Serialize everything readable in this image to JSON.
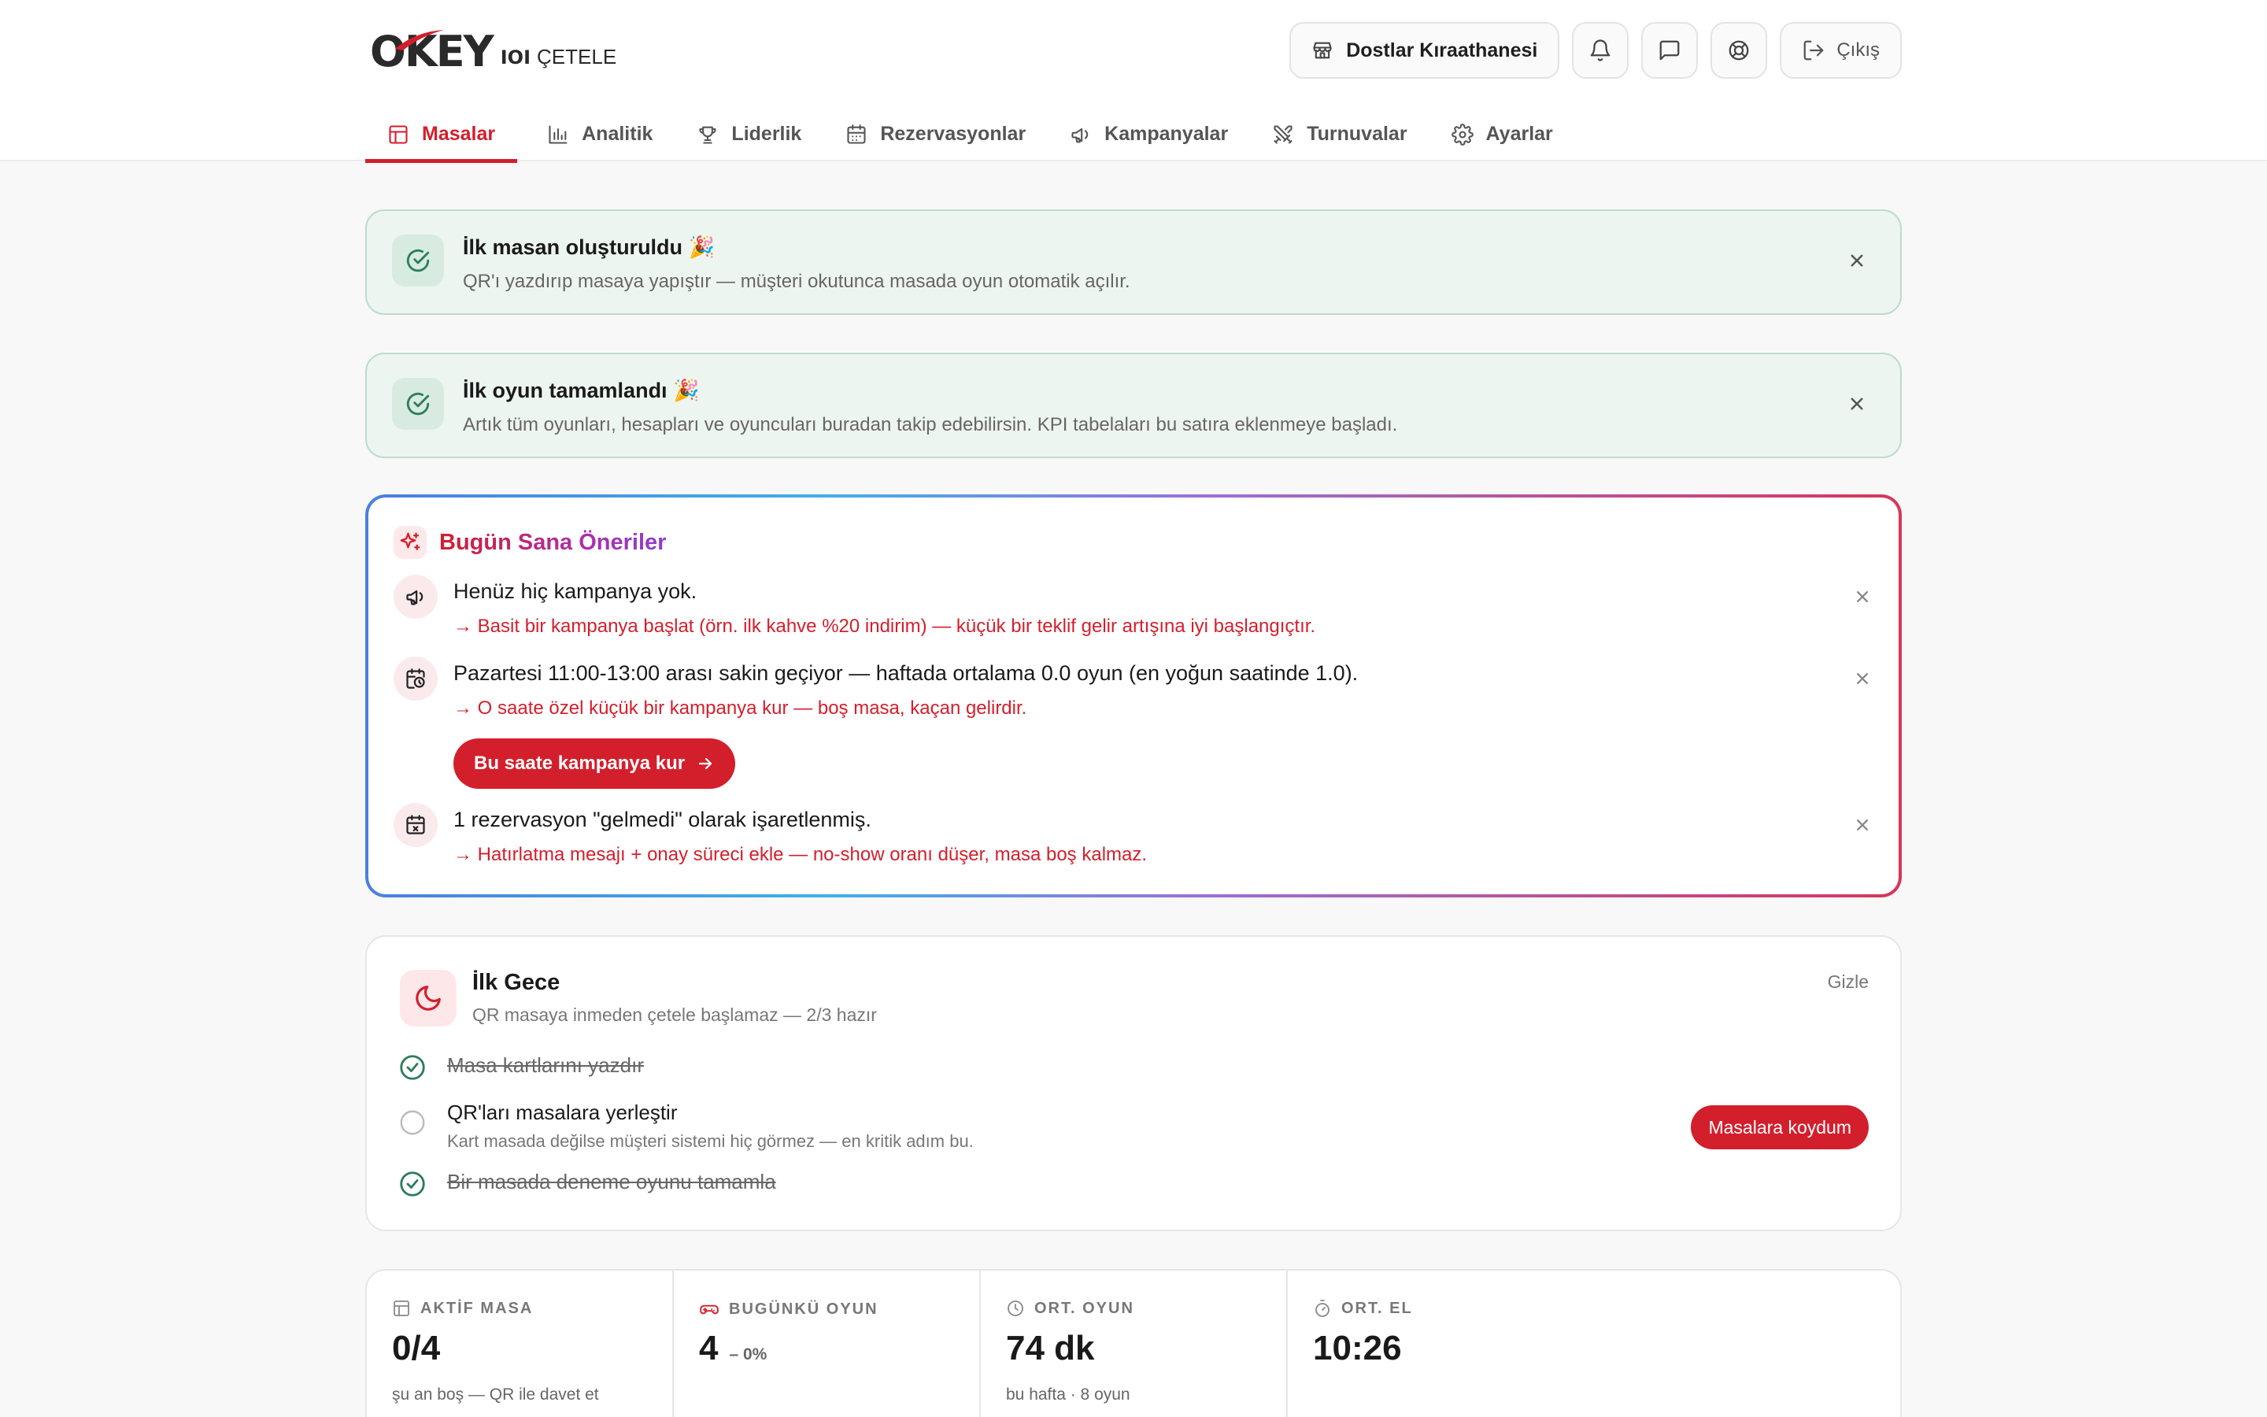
{
  "logo": {
    "brand": "OKEY",
    "io": "IOI",
    "sub": "ÇETELE"
  },
  "header": {
    "venue": "Dostlar Kıraathanesi",
    "logout": "Çıkış"
  },
  "nav": [
    {
      "label": "Masalar",
      "icon": "table-icon"
    },
    {
      "label": "Analitik",
      "icon": "bar-chart-icon"
    },
    {
      "label": "Liderlik",
      "icon": "trophy-icon"
    },
    {
      "label": "Rezervasyonlar",
      "icon": "calendar-icon"
    },
    {
      "label": "Kampanyalar",
      "icon": "megaphone-icon"
    },
    {
      "label": "Turnuvalar",
      "icon": "swords-icon"
    },
    {
      "label": "Ayarlar",
      "icon": "gear-icon"
    }
  ],
  "banners": [
    {
      "title": "İlk masan oluşturuldu 🎉",
      "desc": "QR'ı yazdırıp masaya yapıştır — müşteri okutunca masada oyun otomatik açılır."
    },
    {
      "title": "İlk oyun tamamlandı 🎉",
      "desc": "Artık tüm oyunları, hesapları ve oyuncuları buradan takip edebilirsin. KPI tabelaları bu satıra eklenmeye başladı."
    }
  ],
  "suggestions": {
    "title": "Bugün Sana Öneriler",
    "items": [
      {
        "text": "Henüz hiç kampanya yok.",
        "action": "→ Basit bir kampanya başlat (örn. ilk kahve %20 indirim) — küçük bir teklif gelir artışına iyi başlangıçtır.",
        "icon": "megaphone-icon"
      },
      {
        "text": "Pazartesi 11:00-13:00 arası sakin geçiyor — haftada ortalama 0.0 oyun (en yoğun saatinde 1.0).",
        "action": "→ O saate özel küçük bir kampanya kur — boş masa, kaçan gelirdir.",
        "icon": "calendar-clock-icon"
      },
      {
        "text": "1 rezervasyon \"gelmedi\" olarak işaretlenmiş.",
        "action": "→ Hatırlatma mesajı + onay süreci ekle — no-show oranı düşer, masa boş kalmaz.",
        "icon": "calendar-x-icon"
      }
    ],
    "button": "Bu saate kampanya kur"
  },
  "night": {
    "title": "İlk Gece",
    "subtitle": "QR masaya inmeden çetele başlamaz — 2/3 hazır",
    "hide": "Gizle",
    "steps": [
      {
        "label": "Masa kartlarını yazdır",
        "done": true
      },
      {
        "label": "QR'ları masalara yerleştir",
        "desc": "Kart masada değilse müşteri sistemi hiç görmez — en kritik adım bu.",
        "done": false
      },
      {
        "label": "Bir masada deneme oyunu tamamla",
        "done": true
      }
    ],
    "button": "Masalara koydum"
  },
  "kpis": [
    {
      "label": "AKTİF MASA",
      "value": "0/4",
      "sub": "şu an boş — QR ile davet et",
      "icon": "table-icon"
    },
    {
      "label": "BUGÜNKÜ OYUN",
      "value": "4",
      "delta": "– 0%",
      "icon": "gamepad-icon"
    },
    {
      "label": "ORT. OYUN",
      "value": "74 dk",
      "sub": "bu hafta · 8 oyun",
      "icon": "clock-icon"
    },
    {
      "label": "ORT. EL",
      "value": "10:26",
      "icon": "timer-icon"
    }
  ],
  "colors": {
    "accent": "#d31f2c",
    "success": "#2e7d5b"
  }
}
